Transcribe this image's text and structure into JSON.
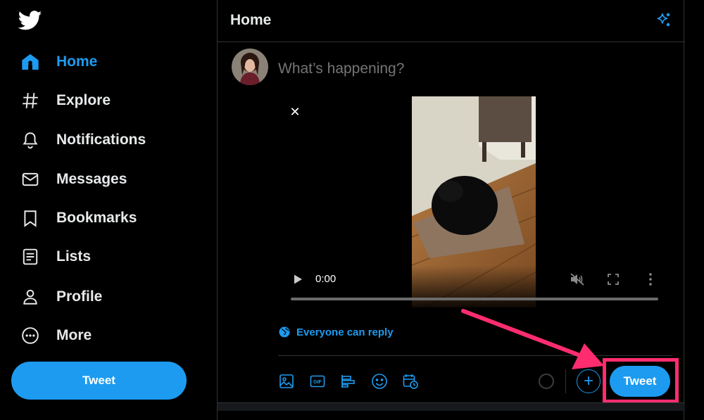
{
  "sidebar": {
    "items": [
      {
        "label": "Home",
        "icon": "home-icon",
        "active": true
      },
      {
        "label": "Explore",
        "icon": "hashtag-icon"
      },
      {
        "label": "Notifications",
        "icon": "bell-icon"
      },
      {
        "label": "Messages",
        "icon": "envelope-icon"
      },
      {
        "label": "Bookmarks",
        "icon": "bookmark-icon"
      },
      {
        "label": "Lists",
        "icon": "list-icon"
      },
      {
        "label": "Profile",
        "icon": "person-icon"
      },
      {
        "label": "More",
        "icon": "more-icon"
      }
    ],
    "tweet_button": "Tweet"
  },
  "header": {
    "title": "Home"
  },
  "composer": {
    "placeholder": "What’s happening?",
    "video": {
      "timecode": "0:00"
    },
    "reply_setting": "Everyone can reply",
    "tweet_button": "Tweet"
  },
  "colors": {
    "accent": "#1d9bf0",
    "highlight": "#ff2d6f",
    "background": "#000000"
  }
}
